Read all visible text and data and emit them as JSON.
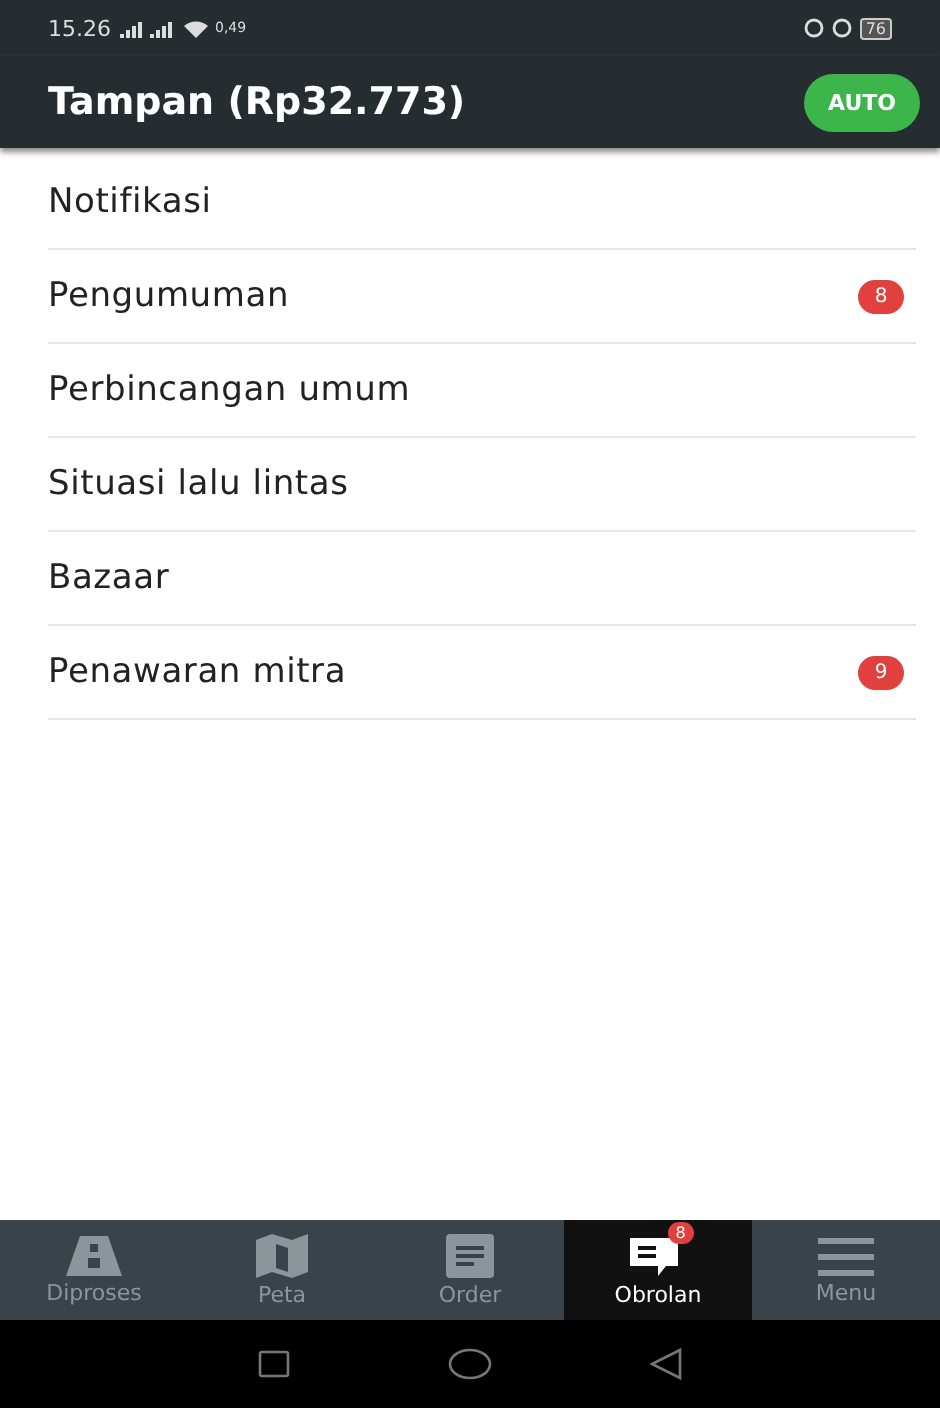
{
  "status_bar": {
    "time": "15.26",
    "speed": "0,49",
    "battery": "76"
  },
  "header": {
    "title": "Tampan (Rp32.773)",
    "auto_button": "AUTO"
  },
  "channels": [
    {
      "name": "Notifikasi"
    },
    {
      "name": "Pengumuman",
      "badge": "8"
    },
    {
      "name": "Perbincangan umum"
    },
    {
      "name": "Situasi lalu lintas"
    },
    {
      "name": "Bazaar"
    },
    {
      "name": "Penawaran mitra",
      "badge": "9"
    }
  ],
  "bottom_nav": [
    {
      "kind": "road",
      "label": "Diproses",
      "selected": false
    },
    {
      "kind": "map",
      "label": "Peta",
      "selected": false
    },
    {
      "kind": "order",
      "label": "Order",
      "selected": false
    },
    {
      "kind": "chat",
      "label": "Obrolan",
      "selected": true,
      "badge": "8"
    },
    {
      "kind": "menu",
      "label": "Menu",
      "selected": false
    }
  ]
}
